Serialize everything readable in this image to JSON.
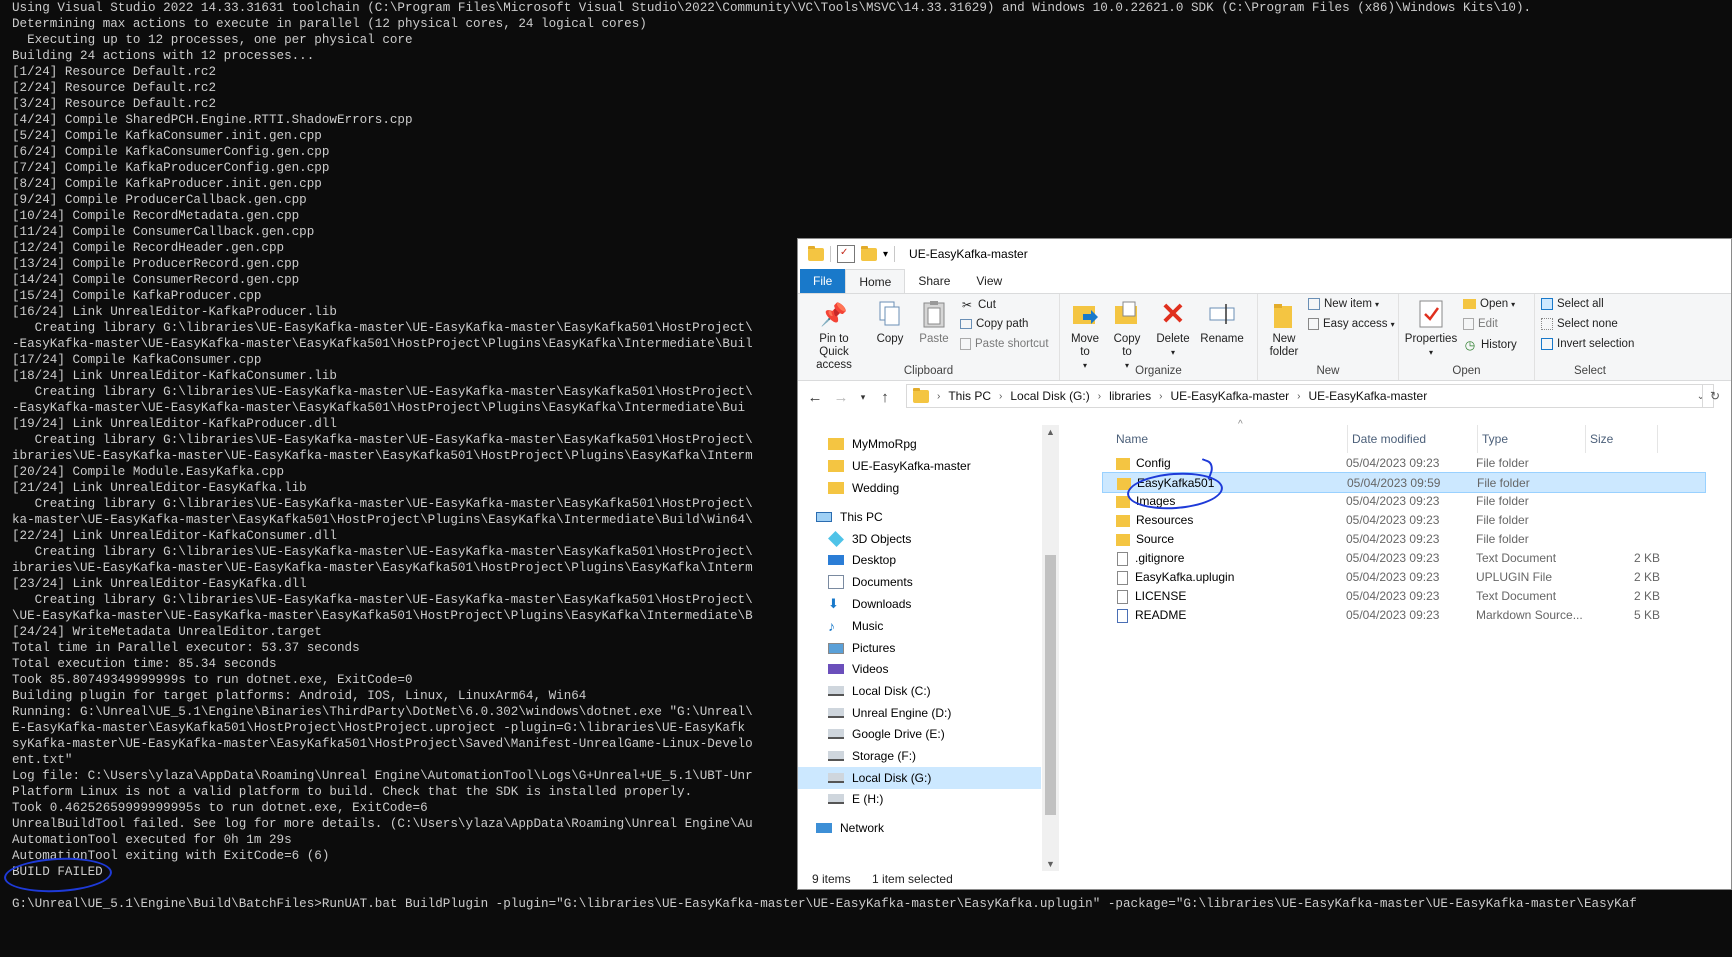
{
  "console": {
    "lines": [
      "Using Visual Studio 2022 14.33.31631 toolchain (C:\\Program Files\\Microsoft Visual Studio\\2022\\Community\\VC\\Tools\\MSVC\\14.33.31629) and Windows 10.0.22621.0 SDK (C:\\Program Files (x86)\\Windows Kits\\10).",
      "Determining max actions to execute in parallel (12 physical cores, 24 logical cores)",
      "  Executing up to 12 processes, one per physical core",
      "Building 24 actions with 12 processes...",
      "[1/24] Resource Default.rc2",
      "[2/24] Resource Default.rc2",
      "[3/24] Resource Default.rc2",
      "[4/24] Compile SharedPCH.Engine.RTTI.ShadowErrors.cpp",
      "[5/24] Compile KafkaConsumer.init.gen.cpp",
      "[6/24] Compile KafkaConsumerConfig.gen.cpp",
      "[7/24] Compile KafkaProducerConfig.gen.cpp",
      "[8/24] Compile KafkaProducer.init.gen.cpp",
      "[9/24] Compile ProducerCallback.gen.cpp",
      "[10/24] Compile RecordMetadata.gen.cpp",
      "[11/24] Compile ConsumerCallback.gen.cpp",
      "[12/24] Compile RecordHeader.gen.cpp",
      "[13/24] Compile ProducerRecord.gen.cpp",
      "[14/24] Compile ConsumerRecord.gen.cpp",
      "[15/24] Compile KafkaProducer.cpp",
      "[16/24] Link UnrealEditor-KafkaProducer.lib",
      "   Creating library G:\\libraries\\UE-EasyKafka-master\\UE-EasyKafka-master\\EasyKafka501\\HostProject\\",
      "-EasyKafka-master\\UE-EasyKafka-master\\EasyKafka501\\HostProject\\Plugins\\EasyKafka\\Intermediate\\Buil",
      "[17/24] Compile KafkaConsumer.cpp",
      "[18/24] Link UnrealEditor-KafkaConsumer.lib",
      "   Creating library G:\\libraries\\UE-EasyKafka-master\\UE-EasyKafka-master\\EasyKafka501\\HostProject\\",
      "-EasyKafka-master\\UE-EasyKafka-master\\EasyKafka501\\HostProject\\Plugins\\EasyKafka\\Intermediate\\Bui",
      "[19/24] Link UnrealEditor-KafkaProducer.dll",
      "   Creating library G:\\libraries\\UE-EasyKafka-master\\UE-EasyKafka-master\\EasyKafka501\\HostProject\\",
      "ibraries\\UE-EasyKafka-master\\UE-EasyKafka-master\\EasyKafka501\\HostProject\\Plugins\\EasyKafka\\Interm",
      "[20/24] Compile Module.EasyKafka.cpp",
      "[21/24] Link UnrealEditor-EasyKafka.lib",
      "   Creating library G:\\libraries\\UE-EasyKafka-master\\UE-EasyKafka-master\\EasyKafka501\\HostProject\\",
      "ka-master\\UE-EasyKafka-master\\EasyKafka501\\HostProject\\Plugins\\EasyKafka\\Intermediate\\Build\\Win64\\",
      "[22/24] Link UnrealEditor-KafkaConsumer.dll",
      "   Creating library G:\\libraries\\UE-EasyKafka-master\\UE-EasyKafka-master\\EasyKafka501\\HostProject\\",
      "ibraries\\UE-EasyKafka-master\\UE-EasyKafka-master\\EasyKafka501\\HostProject\\Plugins\\EasyKafka\\Interm",
      "[23/24] Link UnrealEditor-EasyKafka.dll",
      "   Creating library G:\\libraries\\UE-EasyKafka-master\\UE-EasyKafka-master\\EasyKafka501\\HostProject\\",
      "\\UE-EasyKafka-master\\UE-EasyKafka-master\\EasyKafka501\\HostProject\\Plugins\\EasyKafka\\Intermediate\\B",
      "[24/24] WriteMetadata UnrealEditor.target",
      "Total time in Parallel executor: 53.37 seconds",
      "Total execution time: 85.34 seconds",
      "Took 85.80749349999999s to run dotnet.exe, ExitCode=0",
      "Building plugin for target platforms: Android, IOS, Linux, LinuxArm64, Win64",
      "Running: G:\\Unreal\\UE_5.1\\Engine\\Binaries\\ThirdParty\\DotNet\\6.0.302\\windows\\dotnet.exe \"G:\\Unreal\\",
      "E-EasyKafka-master\\EasyKafka501\\HostProject\\HostProject.uproject -plugin=G:\\libraries\\UE-EasyKafk",
      "syKafka-master\\UE-EasyKafka-master\\EasyKafka501\\HostProject\\Saved\\Manifest-UnrealGame-Linux-Develo",
      "ent.txt\"",
      "Log file: C:\\Users\\ylaza\\AppData\\Roaming\\Unreal Engine\\AutomationTool\\Logs\\G+Unreal+UE_5.1\\UBT-Unr",
      "Platform Linux is not a valid platform to build. Check that the SDK is installed properly.",
      "Took 0.46252659999999995s to run dotnet.exe, ExitCode=6",
      "UnrealBuildTool failed. See log for more details. (C:\\Users\\ylaza\\AppData\\Roaming\\Unreal Engine\\Au",
      "AutomationTool executed for 0h 1m 29s",
      "AutomationTool exiting with ExitCode=6 (6)",
      "BUILD FAILED",
      "",
      "G:\\Unreal\\UE_5.1\\Engine\\Build\\BatchFiles>RunUAT.bat BuildPlugin -plugin=\"G:\\libraries\\UE-EasyKafka-master\\UE-EasyKafka-master\\EasyKafka.uplugin\" -package=\"G:\\libraries\\UE-EasyKafka-master\\UE-EasyKafka-master\\EasyKaf"
    ]
  },
  "explorer": {
    "title": "UE-EasyKafka-master",
    "tabs": [
      "File",
      "Home",
      "Share",
      "View"
    ],
    "ribbon": {
      "clipboard": {
        "label": "Clipboard",
        "pin": "Pin to Quick access",
        "copy": "Copy",
        "paste": "Paste",
        "cut": "Cut",
        "copy_path": "Copy path",
        "paste_shortcut": "Paste shortcut"
      },
      "organize": {
        "label": "Organize",
        "move_to": "Move to",
        "copy_to": "Copy to",
        "delete": "Delete",
        "rename": "Rename"
      },
      "new": {
        "label": "New",
        "new_folder": "New folder",
        "new_item": "New item",
        "easy_access": "Easy access"
      },
      "open": {
        "label": "Open",
        "properties": "Properties",
        "open": "Open",
        "edit": "Edit",
        "history": "History"
      },
      "select": {
        "label": "Select",
        "select_all": "Select all",
        "select_none": "Select none",
        "invert": "Invert selection"
      }
    },
    "address": {
      "crumbs": [
        "This PC",
        "Local Disk (G:)",
        "libraries",
        "UE-EasyKafka-master",
        "UE-EasyKafka-master"
      ]
    },
    "nav_items": [
      {
        "label": "MyMmoRpg",
        "icon": "folder-icon"
      },
      {
        "label": "UE-EasyKafka-master",
        "icon": "folder-icon"
      },
      {
        "label": "Wedding",
        "icon": "folder-icon"
      },
      {
        "label": "This PC",
        "icon": "computer-icon"
      },
      {
        "label": "3D Objects",
        "icon": "3d-objects-icon"
      },
      {
        "label": "Desktop",
        "icon": "desktop-icon"
      },
      {
        "label": "Documents",
        "icon": "documents-icon"
      },
      {
        "label": "Downloads",
        "icon": "downloads-icon"
      },
      {
        "label": "Music",
        "icon": "music-icon"
      },
      {
        "label": "Pictures",
        "icon": "pictures-icon"
      },
      {
        "label": "Videos",
        "icon": "videos-icon"
      },
      {
        "label": "Local Disk (C:)",
        "icon": "drive-icon"
      },
      {
        "label": "Unreal Engine (D:)",
        "icon": "drive-icon"
      },
      {
        "label": "Google Drive (E:)",
        "icon": "drive-icon"
      },
      {
        "label": "Storage (F:)",
        "icon": "drive-icon"
      },
      {
        "label": "Local Disk (G:)",
        "icon": "drive-icon"
      },
      {
        "label": "E (H:)",
        "icon": "drive-icon"
      },
      {
        "label": "Network",
        "icon": "network-icon"
      }
    ],
    "columns": {
      "name": "Name",
      "date": "Date modified",
      "type": "Type",
      "size": "Size"
    },
    "files": [
      {
        "name": "Config",
        "date": "05/04/2023 09:23",
        "type": "File folder",
        "size": "",
        "kind": "folder"
      },
      {
        "name": "EasyKafka501",
        "date": "05/04/2023 09:59",
        "type": "File folder",
        "size": "",
        "kind": "folder"
      },
      {
        "name": "Images",
        "date": "05/04/2023 09:23",
        "type": "File folder",
        "size": "",
        "kind": "folder"
      },
      {
        "name": "Resources",
        "date": "05/04/2023 09:23",
        "type": "File folder",
        "size": "",
        "kind": "folder"
      },
      {
        "name": "Source",
        "date": "05/04/2023 09:23",
        "type": "File folder",
        "size": "",
        "kind": "folder"
      },
      {
        "name": ".gitignore",
        "date": "05/04/2023 09:23",
        "type": "Text Document",
        "size": "2 KB",
        "kind": "doc"
      },
      {
        "name": "EasyKafka.uplugin",
        "date": "05/04/2023 09:23",
        "type": "UPLUGIN File",
        "size": "2 KB",
        "kind": "doc"
      },
      {
        "name": "LICENSE",
        "date": "05/04/2023 09:23",
        "type": "Text Document",
        "size": "2 KB",
        "kind": "doc"
      },
      {
        "name": "README",
        "date": "05/04/2023 09:23",
        "type": "Markdown Source...",
        "size": "5 KB",
        "kind": "md"
      }
    ],
    "status": {
      "count": "9 items",
      "selected": "1 item selected"
    },
    "colors": {
      "accent": "#1979ca",
      "selection": "#cce8ff",
      "annotation": "#1e3ad8"
    }
  }
}
